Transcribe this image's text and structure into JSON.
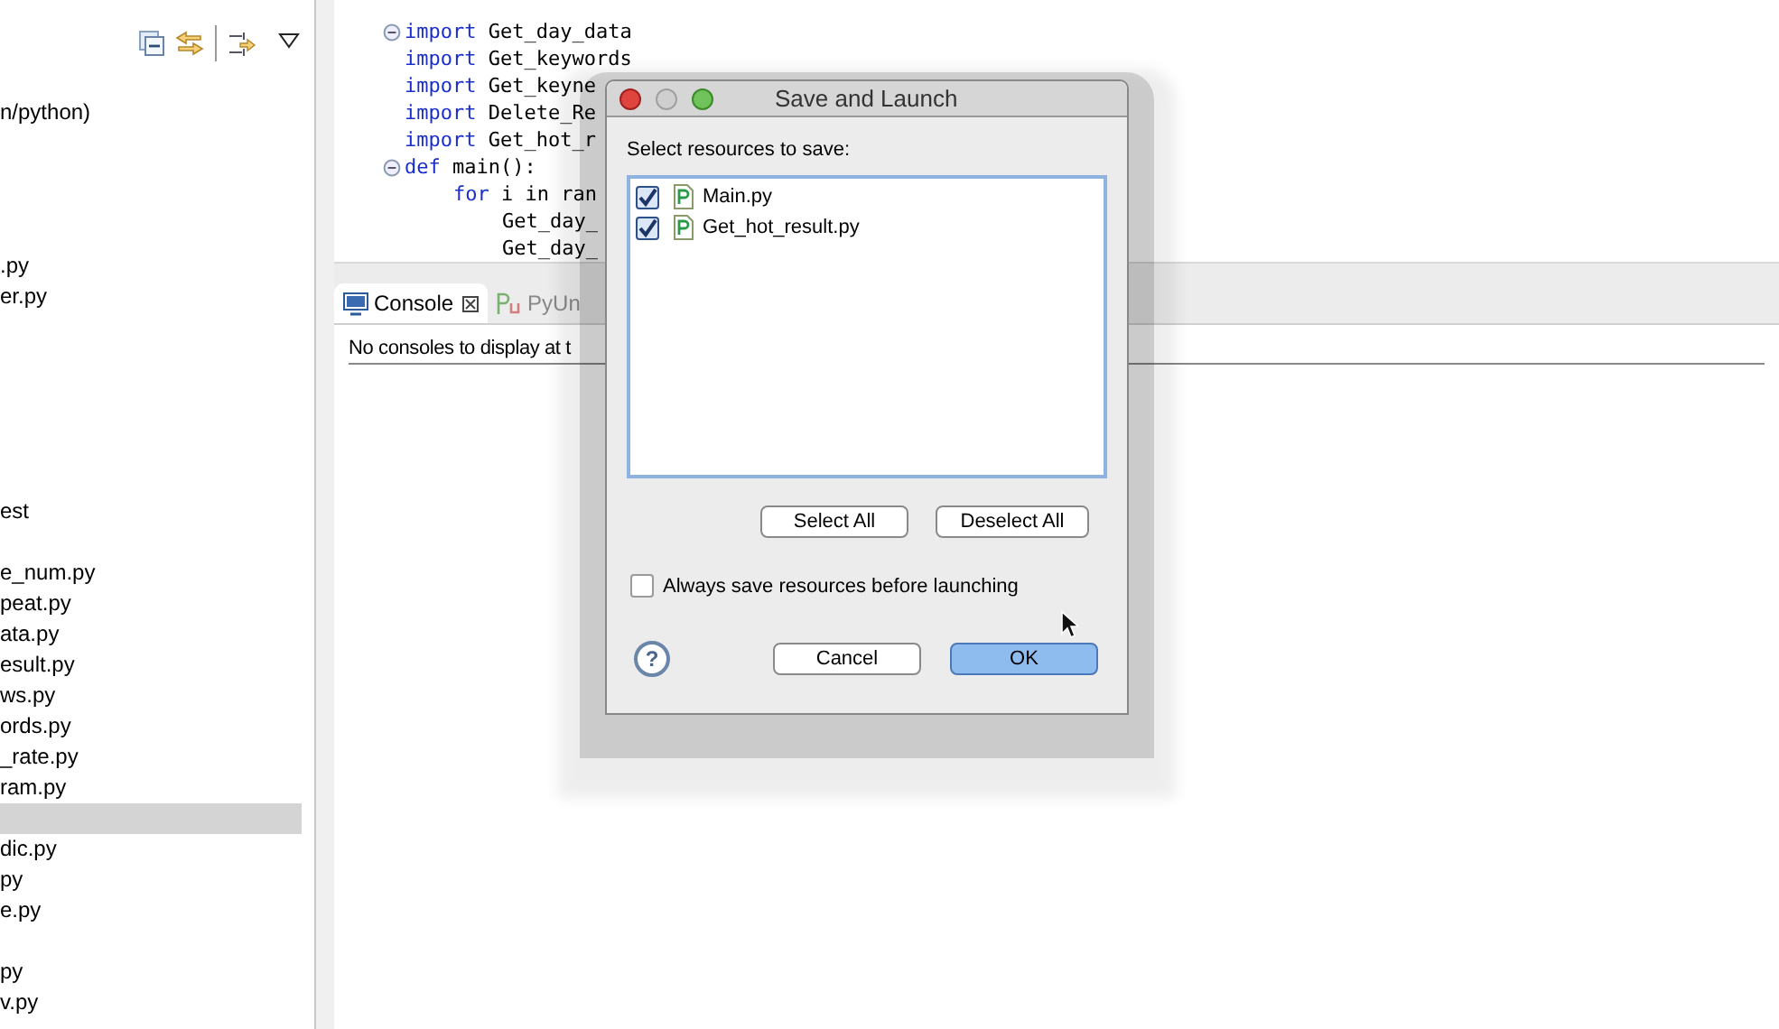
{
  "explorer": {
    "items": [
      {
        "label": "n/python)",
        "selected": false
      },
      {
        "selected": false
      },
      {
        "selected": false
      },
      {
        "selected": false
      },
      {
        "selected": false
      },
      {
        "label": ".py",
        "selected": false
      },
      {
        "label": "er.py",
        "selected": false
      },
      {
        "selected": false
      },
      {
        "selected": false
      },
      {
        "selected": false
      },
      {
        "selected": false
      },
      {
        "selected": false
      },
      {
        "selected": false
      },
      {
        "label": "est",
        "selected": false
      },
      {
        "selected": false
      },
      {
        "label": "e_num.py",
        "selected": false
      },
      {
        "label": "peat.py",
        "selected": false
      },
      {
        "label": "ata.py",
        "selected": false
      },
      {
        "label": "esult.py",
        "selected": false
      },
      {
        "label": "ws.py",
        "selected": false
      },
      {
        "label": "ords.py",
        "selected": false
      },
      {
        "label": "_rate.py",
        "selected": false
      },
      {
        "label": "ram.py",
        "selected": false
      },
      {
        "selected": true
      },
      {
        "label": "dic.py",
        "selected": false
      },
      {
        "label": "py",
        "selected": false
      },
      {
        "label": "e.py",
        "selected": false
      },
      {
        "selected": false
      },
      {
        "label": "py",
        "selected": false
      },
      {
        "label": "v.py",
        "selected": false
      }
    ]
  },
  "editor": {
    "lines": [
      {
        "fold": true,
        "keyword": "import",
        "rest": " Get_day_data"
      },
      {
        "fold": false,
        "keyword": "import",
        "rest": " Get_keywords"
      },
      {
        "fold": false,
        "keyword": "import",
        "rest": " Get_keyne"
      },
      {
        "fold": false,
        "keyword": "import",
        "rest": " Delete_Re"
      },
      {
        "fold": false,
        "keyword": "import",
        "rest": " Get_hot_r"
      },
      {
        "fold": true,
        "keyword": "def",
        "rest": " main():",
        "children": [
          {
            "fold": false,
            "keyword": "for",
            "rest": " i in ran",
            "children": [
              {
                "fold": false,
                "rest": "Get_day_"
              },
              {
                "fold": false,
                "rest": "Get_day_"
              }
            ]
          }
        ]
      }
    ]
  },
  "bottom_panel": {
    "tabs": [
      {
        "label": "Console",
        "selected": true,
        "kind": "console"
      },
      {
        "label": "PyUn",
        "selected": false,
        "kind": "pyunit"
      }
    ],
    "message": "No consoles to display at t"
  },
  "dialog": {
    "title": "Save and Launch",
    "prompt": "Select resources to save:",
    "resources": [
      {
        "name": "Main.py",
        "checked": true
      },
      {
        "name": "Get_hot_result.py",
        "checked": true
      }
    ],
    "select_all": "Select All",
    "deselect_all": "Deselect All",
    "always_save": {
      "label": "Always save resources before launching",
      "checked": false
    },
    "help": "?",
    "cancel": "Cancel",
    "ok": "OK"
  }
}
